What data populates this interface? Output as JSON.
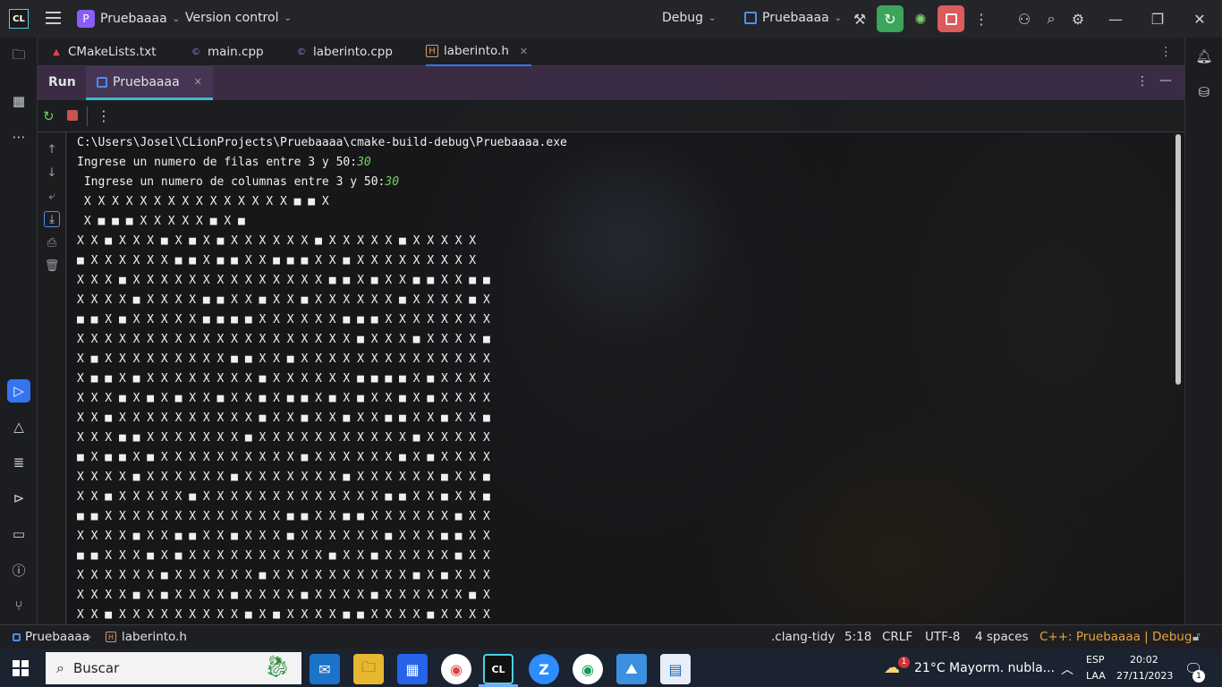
{
  "titlebar": {
    "logo": "CL",
    "project_badge": "P",
    "project_name": "Pruebaaaa",
    "vcs": "Version control",
    "config": "Debug",
    "run_target": "Pruebaaaa"
  },
  "editor_tabs": [
    {
      "label": "CMakeLists.txt",
      "icon": "cmake-icon"
    },
    {
      "label": "main.cpp",
      "icon": "cpp-file-icon"
    },
    {
      "label": "laberinto.cpp",
      "icon": "cpp-file-icon"
    },
    {
      "label": "laberinto.h",
      "icon": "header-file-icon",
      "active": true
    }
  ],
  "run_panel": {
    "title": "Run",
    "tab_label": "Pruebaaaa"
  },
  "console": {
    "path_line": "C:\\Users\\Josel\\CLionProjects\\Pruebaaaa\\cmake-build-debug\\Pruebaaaa.exe",
    "prompt_rows": "Ingrese un numero de filas entre 3 y 50:",
    "input_rows": "30",
    "prompt_cols": " Ingrese un numero de columnas entre 3 y 50:",
    "input_cols": "30",
    "output_lines": [
      " X X X X X X X X X X X X X X X ■ ■ X",
      " X ■ ■ ■ X X X X X ■ X ■",
      "X X ■ X X X ■ X ■ X ■ X X X X X X ■ X X X X X ■ X X X X X",
      "■ X X X X X X ■ ■ X ■ ■ X X ■ ■ ■ X X ■ X X X X X X X X X",
      "X X X ■ X X X X X X X X X X X X X X ■ ■ X ■ X X ■ ■ X X ■ ■",
      "X X X X ■ X X X X ■ ■ X X ■ X X ■ X X X X X X ■ X X X X ■ X",
      "■ ■ X ■ X X X X X ■ ■ ■ ■ X X X X X X ■ ■ ■ X X X X X X X X",
      "X X X X X X X X X X X X X X X X X X X X ■ X X X ■ X X X X ■",
      "X ■ X X X X X X X X X ■ ■ X X ■ X X X X X X X X X X X X X X",
      "X ■ ■ X ■ X X X X X X X X ■ X X X X X X ■ ■ ■ ■ X ■ X X X X",
      "X X X ■ X ■ X ■ X X ■ X X ■ X ■ ■ X ■ X ■ X X ■ X ■ X X X X",
      "X X ■ X X X X X X X X X X ■ X X ■ X X ■ X X ■ ■ X X ■ X X ■",
      "X X X ■ ■ X X X X X X X ■ X X X X X X X X X X X ■ X X X X X",
      "■ X ■ ■ X ■ X X X X X X X X X X ■ X X X X X X ■ X ■ X X X X",
      "X X X X ■ X X X X X X ■ X X X X X X X ■ X X X X X X ■ X X ■",
      "X X ■ X X X X X ■ X X X X X X X X X X X X X ■ ■ X X ■ X X ■",
      "■ ■ X X X X X X X X X X X X X ■ ■ X X ■ ■ X X X X X X ■ X X",
      "X X X X ■ X X ■ ■ X X ■ X X X ■ X X X X X X ■ X X X ■ ■ X X",
      "■ ■ X X X ■ X ■ X X X X X X X X X X ■ X X ■ X X X X X ■ X X",
      "X X X X X X ■ X X X X X X ■ X X X X X X X X X X ■ X ■ X X X",
      "X X X X ■ X ■ X X X X ■ X X X X ■ X X X X ■ X X X X X X ■ X",
      "X X ■ X X X X X X X X X ■ X ■ X X X X ■ ■ X X X X ■ X X X X"
    ]
  },
  "statusbar": {
    "project": "Pruebaaaa",
    "file": "laberinto.h",
    "linter": ".clang-tidy",
    "position": "5:18",
    "line_sep": "CRLF",
    "encoding": "UTF-8",
    "indent": "4 spaces",
    "context": "C++: Pruebaaaa | Debug"
  },
  "taskbar": {
    "search_placeholder": "Buscar",
    "weather_temp": "21°C",
    "weather_desc": "Mayorm. nubla...",
    "weather_badge": "1",
    "lang": "ESP",
    "layout": "LAA",
    "time": "20:02",
    "date": "27/11/2023",
    "notif_count": "1"
  },
  "colors": {
    "accent": "#3574f0",
    "run_green": "#3ba55c",
    "stop_red": "#db5c5c",
    "context_orange": "#e8a33d"
  }
}
